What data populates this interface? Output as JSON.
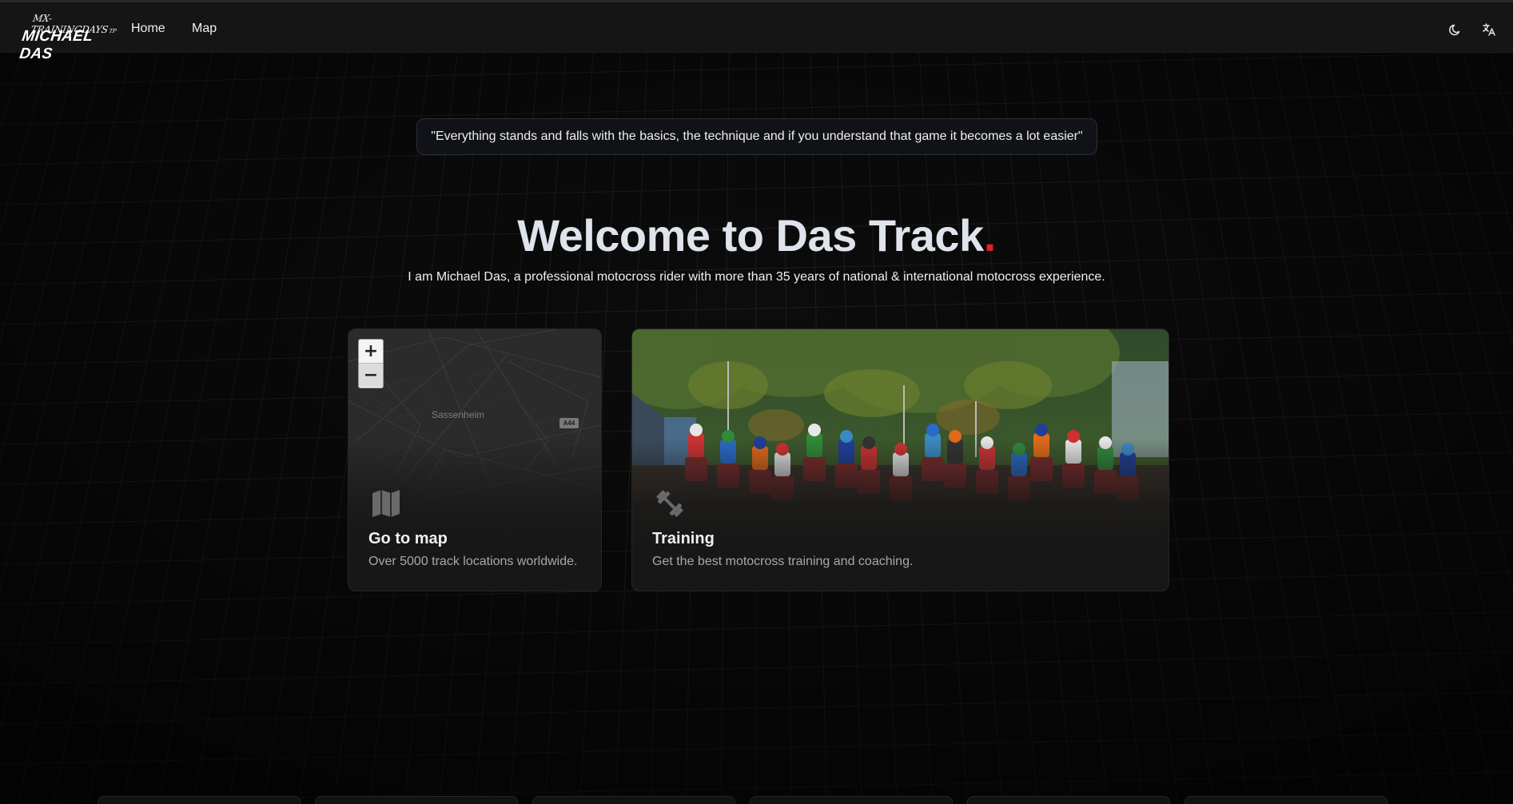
{
  "nav": {
    "logo_top": "MX-TRAININGDAYS",
    "logo_sup": "TP",
    "logo_bottom": "MICHAEL DAS",
    "links": [
      {
        "label": "Home"
      },
      {
        "label": "Map"
      }
    ],
    "icons": [
      "moon-icon",
      "translate-icon"
    ]
  },
  "quote": "\"Everything stands and falls with the basics, the technique and if you understand that game it becomes a lot easier\"",
  "hero": {
    "title": "Welcome to Das Track",
    "title_dot": ".",
    "accent_color": "#e11d2e",
    "subtitle": "I am Michael Das, a professional motocross rider with more than 35 years of national & international motocross experience."
  },
  "cards": {
    "map": {
      "title": "Go to map",
      "description": "Over 5000 track locations worldwide.",
      "icon": "map-icon",
      "map_place_label": "Sassenheim",
      "road_label": "A44",
      "zoom_in": "+",
      "zoom_out": "−"
    },
    "training": {
      "title": "Training",
      "description": "Get the best motocross training and coaching.",
      "icon": "dumbbell-icon"
    }
  }
}
